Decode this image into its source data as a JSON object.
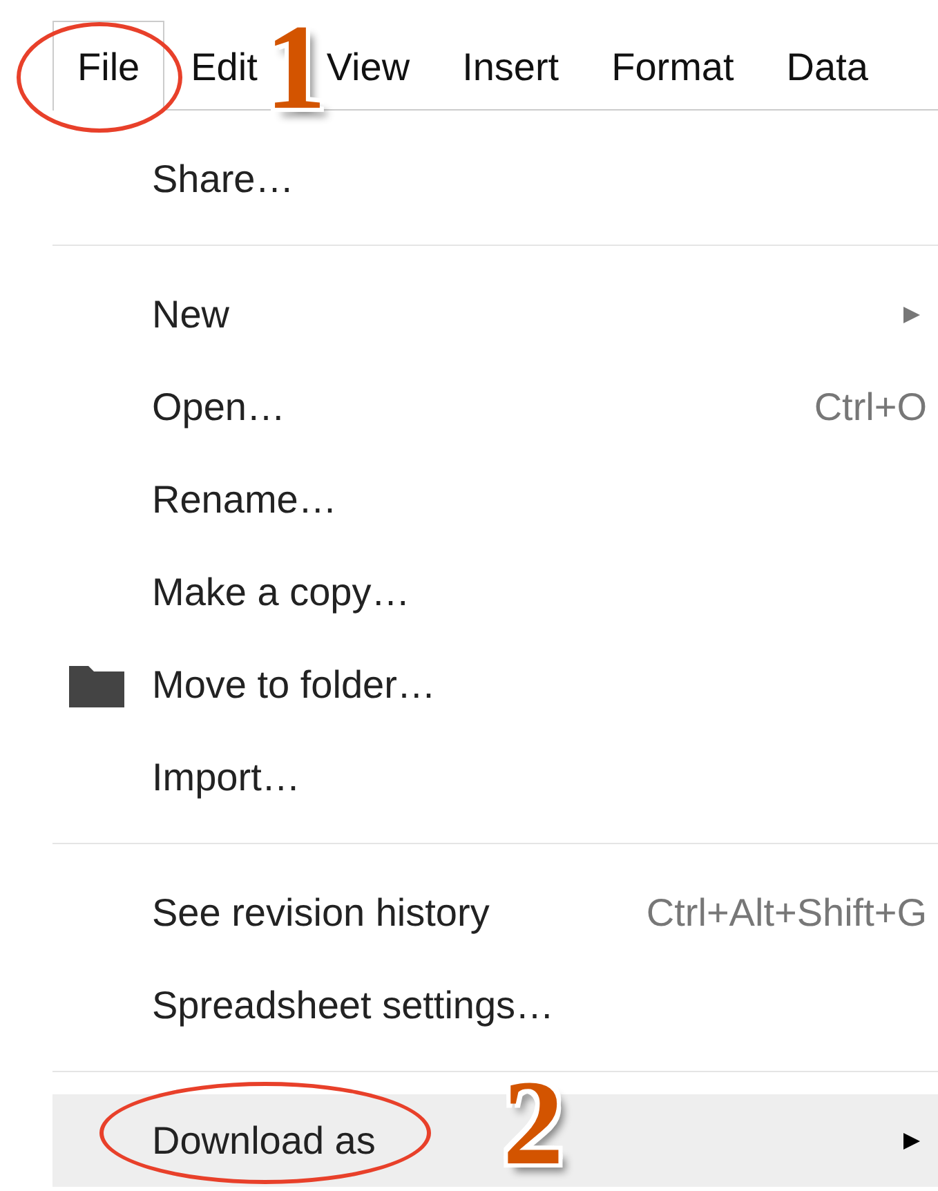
{
  "menu_bar": [
    {
      "label": "File",
      "selected": true
    },
    {
      "label": "Edit",
      "selected": false
    },
    {
      "label": "View",
      "selected": false
    },
    {
      "label": "Insert",
      "selected": false
    },
    {
      "label": "Format",
      "selected": false
    },
    {
      "label": "Data",
      "selected": false
    }
  ],
  "file_menu": [
    {
      "kind": "item",
      "label": "Share…",
      "submenu": false,
      "selected": false
    },
    {
      "kind": "separator"
    },
    {
      "kind": "item",
      "label": "New",
      "submenu": true,
      "selected": false
    },
    {
      "kind": "item",
      "label": "Open…",
      "shortcut": "Ctrl+O",
      "submenu": false,
      "selected": false
    },
    {
      "kind": "item",
      "label": "Rename…",
      "submenu": false,
      "selected": false
    },
    {
      "kind": "item",
      "label": "Make a copy…",
      "submenu": false,
      "selected": false
    },
    {
      "kind": "folder",
      "label": "Move to folder…",
      "submenu": false,
      "selected": false
    },
    {
      "kind": "item",
      "label": "Import…",
      "submenu": false,
      "selected": false
    },
    {
      "kind": "separator"
    },
    {
      "kind": "item",
      "label": "See revision history",
      "shortcut": "Ctrl+Alt+Shift+G",
      "submenu": false,
      "selected": false
    },
    {
      "kind": "item",
      "label": "Spreadsheet settings…",
      "submenu": false,
      "selected": false
    },
    {
      "kind": "separator"
    },
    {
      "kind": "item",
      "label": "Download as",
      "submenu": true,
      "selected": true
    }
  ],
  "annotations": [
    {
      "number": "1"
    },
    {
      "number": "2"
    }
  ]
}
